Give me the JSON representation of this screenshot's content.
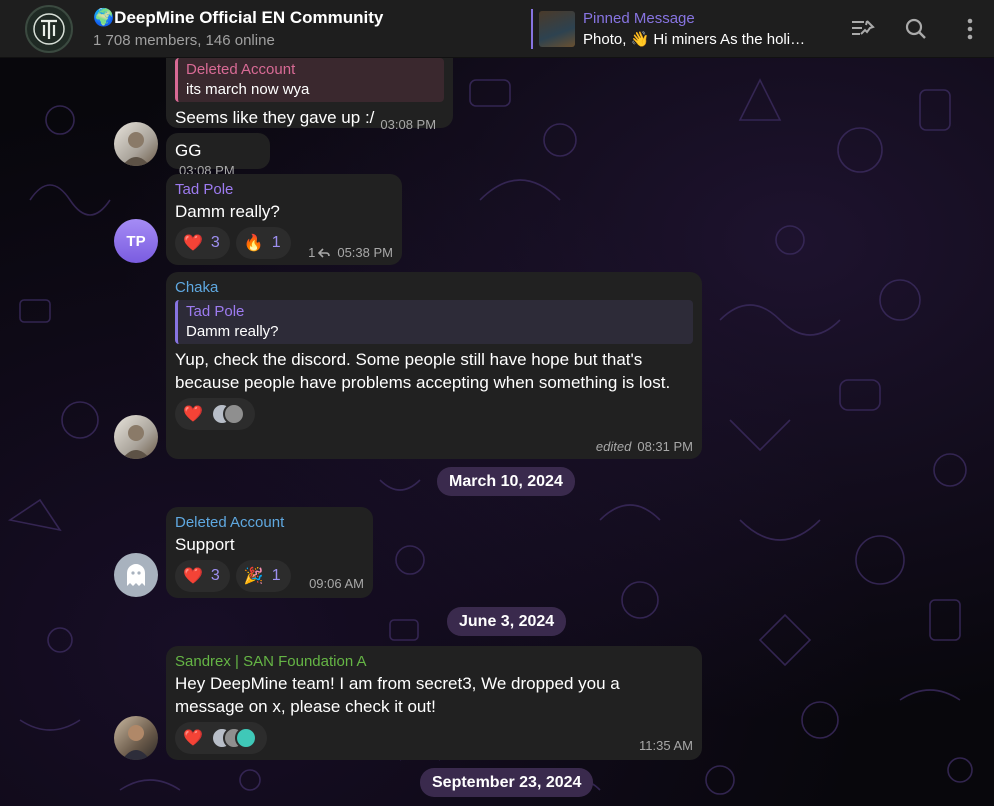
{
  "header": {
    "title_emoji": "🌍",
    "title": "DeepMine Official EN Community",
    "subtitle": "1 708 members, 146 online",
    "pinned_label": "Pinned Message",
    "pinned_text": "Photo, 👋 Hi miners As the holi…"
  },
  "icons": [
    "pinned-list-icon",
    "search-icon",
    "more-vertical-icon"
  ],
  "accent": "#8774e1",
  "messages": [
    {
      "reply_name": "Deleted Account",
      "reply_text": "its march now wya",
      "text": "Seems like they gave up :/",
      "time": "03:08 PM"
    },
    {
      "text": "GG",
      "time": "03:08 PM"
    },
    {
      "sender": "Tad Pole",
      "sender_color": "#9d7bf0",
      "text": "Damm really?",
      "reactions": [
        {
          "emoji": "❤️",
          "count": "3"
        },
        {
          "emoji": "🔥",
          "count": "1"
        }
      ],
      "replies": "1",
      "time": "05:38 PM",
      "avatar_initials": "TP"
    },
    {
      "sender": "Chaka",
      "sender_color": "#5fa8e0",
      "reply_name": "Tad Pole",
      "reply_text": "Damm really?",
      "text": "Yup,  check the discord. Some people still have hope but that's because people have problems accepting when something is lost.",
      "reactions": [
        {
          "emoji": "❤️"
        }
      ],
      "edited": "edited",
      "time": "08:31 PM"
    },
    {
      "sender": "Deleted Account",
      "sender_color": "#5fa8e0",
      "text": "Support",
      "reactions": [
        {
          "emoji": "❤️",
          "count": "3"
        },
        {
          "emoji": "🎉",
          "count": "1"
        }
      ],
      "time": "09:06 AM"
    },
    {
      "sender": "Sandrex | SAN Foundation A",
      "sender_color": "#65b545",
      "text": "Hey DeepMine team! I am from secret3, We dropped you a message on x, please check it out!",
      "reactions": [
        {
          "emoji": "❤️"
        }
      ],
      "time": "11:35 AM"
    }
  ],
  "dates": [
    "March 10, 2024",
    "June 3, 2024",
    "September 23, 2024"
  ]
}
